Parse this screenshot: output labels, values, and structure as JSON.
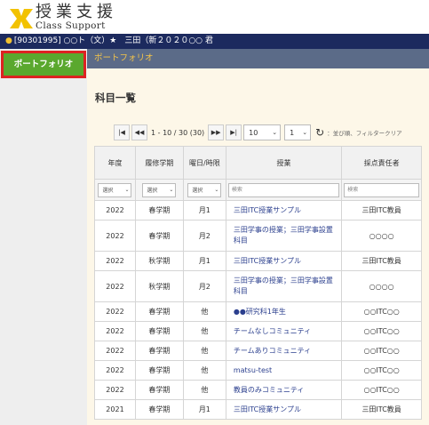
{
  "header": {
    "title": "授業支援",
    "subtitle": "Class Support"
  },
  "userbar": {
    "text": "[90301995] ○○ト（文）★　三田（新２０２０○○ 君"
  },
  "sidebar": {
    "portfolio_button": "ポートフォリオ"
  },
  "breadcrumb": {
    "current": "ポートフォリオ"
  },
  "main": {
    "title": "科目一覧"
  },
  "pager": {
    "first": "⏮",
    "prev": "◀◀",
    "info": "1 - 10 / 30 (30)",
    "next": "▶▶",
    "last": "⏭",
    "per_page": "10",
    "page": "1",
    "hint": "：並び順、フィルタークリア"
  },
  "table": {
    "headers": [
      "年度",
      "履修学期",
      "曜日/時限",
      "授業",
      "採点責任者"
    ],
    "filters": {
      "select_label": "選択",
      "search_placeholder": "検索"
    },
    "rows": [
      {
        "year": "2022",
        "term": "春学期",
        "slot": "月1",
        "course": "三田ITC授業サンプル",
        "grader": "三田ITC教員"
      },
      {
        "year": "2022",
        "term": "春学期",
        "slot": "月2",
        "course": "三田学事の授業；三田学事設置科目",
        "grader": "○○○○"
      },
      {
        "year": "2022",
        "term": "秋学期",
        "slot": "月1",
        "course": "三田ITC授業サンプル",
        "grader": "三田ITC教員"
      },
      {
        "year": "2022",
        "term": "秋学期",
        "slot": "月2",
        "course": "三田学事の授業；三田学事設置科目",
        "grader": "○○○○"
      },
      {
        "year": "2022",
        "term": "春学期",
        "slot": "他",
        "course": "●●研究科1年生",
        "grader": "○○ITC○○"
      },
      {
        "year": "2022",
        "term": "春学期",
        "slot": "他",
        "course": "チームなしコミュニティ",
        "grader": "○○ITC○○"
      },
      {
        "year": "2022",
        "term": "春学期",
        "slot": "他",
        "course": "チームありコミュニティ",
        "grader": "○○ITC○○"
      },
      {
        "year": "2022",
        "term": "春学期",
        "slot": "他",
        "course": "matsu-test",
        "grader": "○○ITC○○"
      },
      {
        "year": "2022",
        "term": "春学期",
        "slot": "他",
        "course": "教員のみコミュニティ",
        "grader": "○○ITC○○"
      },
      {
        "year": "2021",
        "term": "春学期",
        "slot": "月1",
        "course": "三田ITC授業サンプル",
        "grader": "三田ITC教員"
      }
    ]
  },
  "colors": {
    "navy": "#1c2a5e",
    "green": "#5aa82e",
    "highlight_border": "#dd2222",
    "crumb_bg": "#5b6b88",
    "crumb_text": "#f4c44a",
    "link": "#2b3f8e",
    "logo_yellow": "#f2c200"
  }
}
